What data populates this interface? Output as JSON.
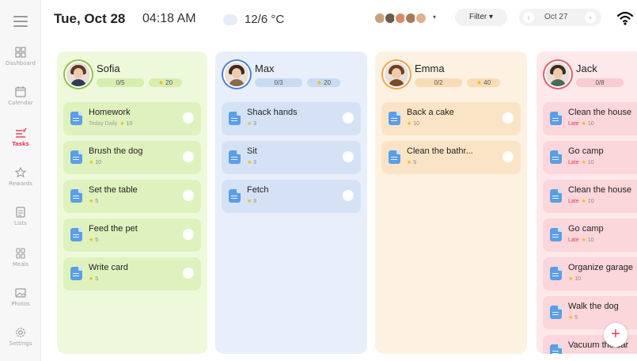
{
  "header": {
    "date": "Tue, Oct 28",
    "time": "04:18 AM",
    "temperature": "12/6 °C",
    "filter_label": "Filter ▾",
    "date_nav_label": "Oct 27",
    "prev_arrow": "‹",
    "next_arrow": "›",
    "caret": "▾"
  },
  "sidebar": {
    "items": [
      {
        "label": "Dashboard",
        "icon": "dashboard-icon"
      },
      {
        "label": "Calendar",
        "icon": "calendar-icon"
      },
      {
        "label": "Tasks",
        "icon": "tasks-icon",
        "active": true
      },
      {
        "label": "Rewards",
        "icon": "star-icon"
      },
      {
        "label": "Lists",
        "icon": "list-icon"
      },
      {
        "label": "Meals",
        "icon": "meals-icon"
      },
      {
        "label": "Photos",
        "icon": "photo-icon"
      },
      {
        "label": "Settings",
        "icon": "gear-icon"
      }
    ]
  },
  "columns": [
    {
      "name": "Sofia",
      "progress": "0/5",
      "points": "20",
      "colors": {
        "bg": "#eef9dc",
        "card": "#dff2be",
        "chip": "#d6eeae"
      },
      "tasks": [
        {
          "name": "Homework",
          "schedule": "Today Daily",
          "late": false,
          "points": "10"
        },
        {
          "name": "Brush the dog",
          "late": false,
          "points": "10"
        },
        {
          "name": "Set the table",
          "late": false,
          "points": "5"
        },
        {
          "name": "Feed the pet",
          "late": false,
          "points": "5"
        },
        {
          "name": "Write card",
          "late": false,
          "points": "5"
        }
      ]
    },
    {
      "name": "Max",
      "progress": "0/3",
      "points": "20",
      "colors": {
        "bg": "#e8effb",
        "card": "#d5e2f6",
        "chip": "#c9daf3"
      },
      "tasks": [
        {
          "name": "Shack hands",
          "late": false,
          "points": "3"
        },
        {
          "name": "Sit",
          "late": false,
          "points": "3"
        },
        {
          "name": "Fetch",
          "late": false,
          "points": "3"
        }
      ]
    },
    {
      "name": "Emma",
      "progress": "0/2",
      "points": "40",
      "colors": {
        "bg": "#fdf1e2",
        "card": "#fbe4c6",
        "chip": "#f8dcb6"
      },
      "tasks": [
        {
          "name": "Back a cake",
          "late": false,
          "points": "10"
        },
        {
          "name": "Clean the bathr...",
          "late": false,
          "points": "5"
        }
      ]
    },
    {
      "name": "Jack",
      "progress": "0/8",
      "points": "",
      "colors": {
        "bg": "#fde8ea",
        "card": "#fbd6da",
        "chip": "#f9ccd1"
      },
      "tasks": [
        {
          "name": "Clean the house",
          "late": true,
          "late_label": "Late",
          "points": "10"
        },
        {
          "name": "Go camp",
          "late": true,
          "late_label": "Late",
          "points": "10"
        },
        {
          "name": "Clean the house",
          "late": true,
          "late_label": "Late",
          "points": "10"
        },
        {
          "name": "Go camp",
          "late": true,
          "late_label": "Late",
          "points": "10"
        },
        {
          "name": "Organize garage",
          "late": false,
          "points": "10"
        },
        {
          "name": "Walk the dog",
          "late": false,
          "points": "5"
        },
        {
          "name": "Vacuum the car",
          "late": false,
          "points": ""
        }
      ]
    }
  ],
  "fab_label": "+"
}
